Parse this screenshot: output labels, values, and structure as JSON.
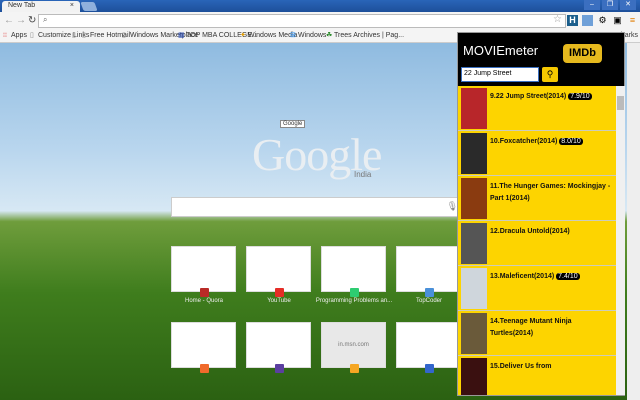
{
  "browser": {
    "tab_title": "New Tab",
    "tab_close": "×",
    "win_buttons": [
      "–",
      "❐",
      "✕"
    ],
    "address": "",
    "bookmarks": [
      "Apps",
      "Customize Links",
      "",
      "Free Hotmail",
      "Windows Marketplace",
      "TOP MBA COLLEGE...",
      "Windows Media",
      "Windows",
      "Trees Archives | Pag...",
      "...harks"
    ]
  },
  "newtab": {
    "logo": "Google",
    "region": "India",
    "tooltip": "Google",
    "search_placeholder": "",
    "tiles": [
      {
        "label": "Home - Quora",
        "color": "#b92b27"
      },
      {
        "label": "YouTube",
        "color": "#e52d27"
      },
      {
        "label": "Programming Problems an...",
        "color": "#2ecc71"
      },
      {
        "label": "TopCoder",
        "color": "#4a90d9"
      },
      {
        "label": "",
        "color": "#f06a2b"
      },
      {
        "label": "",
        "color": "#5b3fa0"
      },
      {
        "label": "",
        "color": "#f5a623",
        "text": "in.msn.com"
      },
      {
        "label": "",
        "color": "#3366cc"
      }
    ]
  },
  "popup": {
    "title": "MOVIEmeter",
    "imdb": "IMDb",
    "search_value": "22 Jump Street",
    "items": [
      {
        "title": "9.22 Jump Street(2014)",
        "rating": "7.9/10",
        "poster": "#b8262a"
      },
      {
        "title": "10.Foxcatcher(2014)",
        "rating": "8.0/10",
        "poster": "#2a2a2a"
      },
      {
        "title": "11.The Hunger Games: Mockingjay - Part 1(2014)",
        "rating": null,
        "poster": "#8a3b10"
      },
      {
        "title": "12.Dracula Untold(2014)",
        "rating": null,
        "poster": "#555"
      },
      {
        "title": "13.Maleficent(2014)",
        "rating": "7.4/10",
        "poster": "#cfd6dc"
      },
      {
        "title": "14.Teenage Mutant Ninja Turtles(2014)",
        "rating": null,
        "poster": "#6a5a3a"
      },
      {
        "title": "15.Deliver Us from",
        "rating": null,
        "poster": "#3a1010"
      }
    ]
  }
}
